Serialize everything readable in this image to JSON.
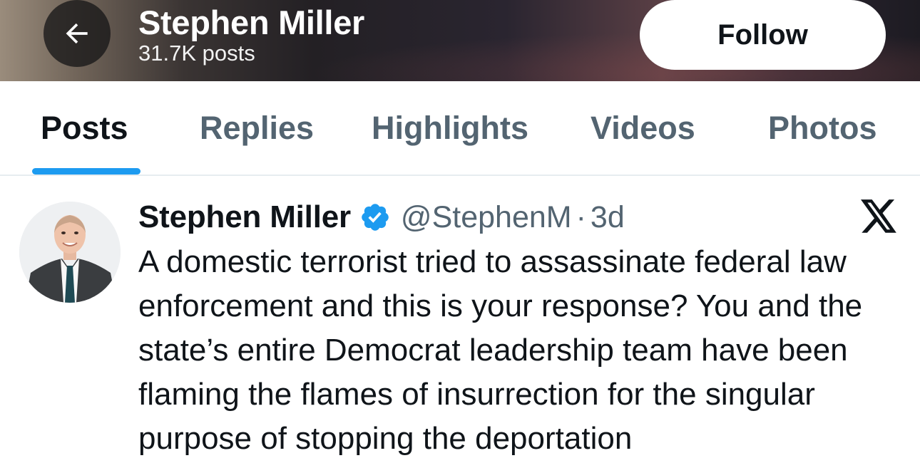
{
  "header": {
    "name": "Stephen Miller",
    "posts_count": "31.7K posts",
    "follow_label": "Follow",
    "back_icon": "arrow-left-icon"
  },
  "tabs": [
    {
      "label": "Posts",
      "active": true
    },
    {
      "label": "Replies",
      "active": false
    },
    {
      "label": "Highlights",
      "active": false
    },
    {
      "label": "Videos",
      "active": false
    },
    {
      "label": "Photos",
      "active": false
    }
  ],
  "post": {
    "author": "Stephen Miller",
    "handle": "@StephenM",
    "separator": "·",
    "time": "3d",
    "verified_icon": "verified-badge-icon",
    "platform_icon": "x-logo-icon",
    "text": "A domestic terrorist tried to assassinate federal law enforcement and this is your response? You and the state’s entire Democrat leadership team have been flaming the flames of insurrection for the singular purpose of stopping the deportation"
  },
  "colors": {
    "accent": "#1d9bf0",
    "text_primary": "#0f1419",
    "text_secondary": "#536471",
    "tab_divider": "#e6ecf0"
  }
}
